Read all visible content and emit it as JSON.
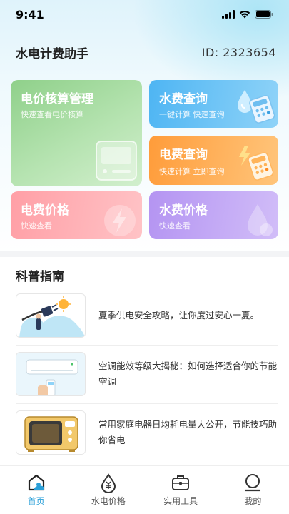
{
  "status_bar": {
    "time": "9:41"
  },
  "header": {
    "title": "水电计费助手",
    "user_id": "ID: 2323654"
  },
  "cards": {
    "electricity_management": {
      "title": "电价核算管理",
      "subtitle": "快速查看电价核算"
    },
    "water_query": {
      "title": "水费查询",
      "subtitle": "一键计算 快速查询"
    },
    "electricity_query": {
      "title": "电费查询",
      "subtitle": "快速计算 立即查询"
    },
    "electricity_price": {
      "title": "电费价格",
      "subtitle": "快速查看"
    },
    "water_price": {
      "title": "水费价格",
      "subtitle": "快速查看"
    }
  },
  "guide": {
    "title": "科普指南",
    "articles": [
      {
        "text": "夏季供电安全攻略，让你度过安心一夏。"
      },
      {
        "text": "空调能效等级大揭秘：如何选择适合你的节能空调"
      },
      {
        "text": "常用家庭电器日均耗电量大公开，节能技巧助你省电"
      }
    ]
  },
  "tabbar": {
    "items": [
      {
        "label": "首页",
        "icon": "home-icon",
        "active": true
      },
      {
        "label": "水电价格",
        "icon": "water-price-icon",
        "active": false
      },
      {
        "label": "实用工具",
        "icon": "toolbox-icon",
        "active": false
      },
      {
        "label": "我的",
        "icon": "profile-icon",
        "active": false
      }
    ]
  },
  "colors": {
    "accent": "#2a9fd8",
    "green_card": "#8fd08a",
    "blue_card": "#4eb5f3",
    "orange_card": "#ff9c3a",
    "pink_card": "#ff9fa6",
    "purple_card": "#b494f2"
  }
}
